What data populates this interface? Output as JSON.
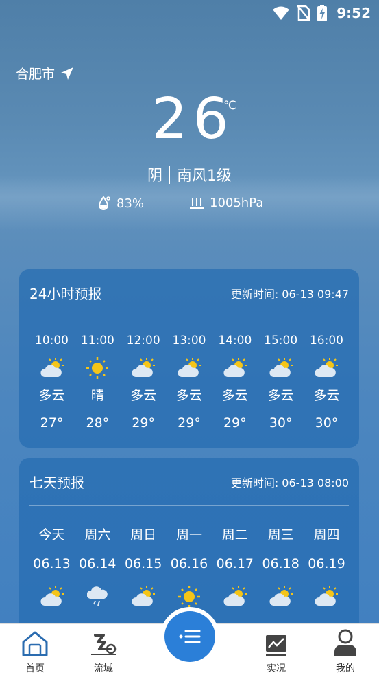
{
  "status_bar": {
    "time": "9:52"
  },
  "location": {
    "city": "合肥市"
  },
  "current": {
    "temperature": "26",
    "unit": "℃",
    "condition": "阴",
    "wind": "南风1级",
    "humidity": "83%",
    "pressure": "1005hPa"
  },
  "hourly": {
    "title": "24小时预报",
    "updated": "更新时间: 06-13 09:47",
    "items": [
      {
        "time": "10:00",
        "icon": "partly-cloudy-icon",
        "cond": "多云",
        "temp": "27°"
      },
      {
        "time": "11:00",
        "icon": "sunny-icon",
        "cond": "晴",
        "temp": "28°"
      },
      {
        "time": "12:00",
        "icon": "partly-cloudy-icon",
        "cond": "多云",
        "temp": "29°"
      },
      {
        "time": "13:00",
        "icon": "partly-cloudy-icon",
        "cond": "多云",
        "temp": "29°"
      },
      {
        "time": "14:00",
        "icon": "partly-cloudy-icon",
        "cond": "多云",
        "temp": "29°"
      },
      {
        "time": "15:00",
        "icon": "partly-cloudy-icon",
        "cond": "多云",
        "temp": "30°"
      },
      {
        "time": "16:00",
        "icon": "partly-cloudy-icon",
        "cond": "多云",
        "temp": "30°"
      }
    ]
  },
  "daily": {
    "title": "七天预报",
    "updated": "更新时间: 06-13 08:00",
    "items": [
      {
        "day": "今天",
        "date": "06.13",
        "icon": "partly-cloudy-icon"
      },
      {
        "day": "周六",
        "date": "06.14",
        "icon": "rain-cloud-icon"
      },
      {
        "day": "周日",
        "date": "06.15",
        "icon": "partly-cloudy-icon"
      },
      {
        "day": "周一",
        "date": "06.16",
        "icon": "sunny-icon"
      },
      {
        "day": "周二",
        "date": "06.17",
        "icon": "partly-cloudy-icon"
      },
      {
        "day": "周三",
        "date": "06.18",
        "icon": "partly-cloudy-icon"
      },
      {
        "day": "周四",
        "date": "06.19",
        "icon": "partly-cloudy-icon"
      }
    ]
  },
  "nav": {
    "home": "首页",
    "basin": "流域",
    "live": "实况",
    "mine": "我的"
  },
  "colors": {
    "accent": "#2b7fd8",
    "sun": "#f5c518",
    "card": "#266cb2"
  }
}
